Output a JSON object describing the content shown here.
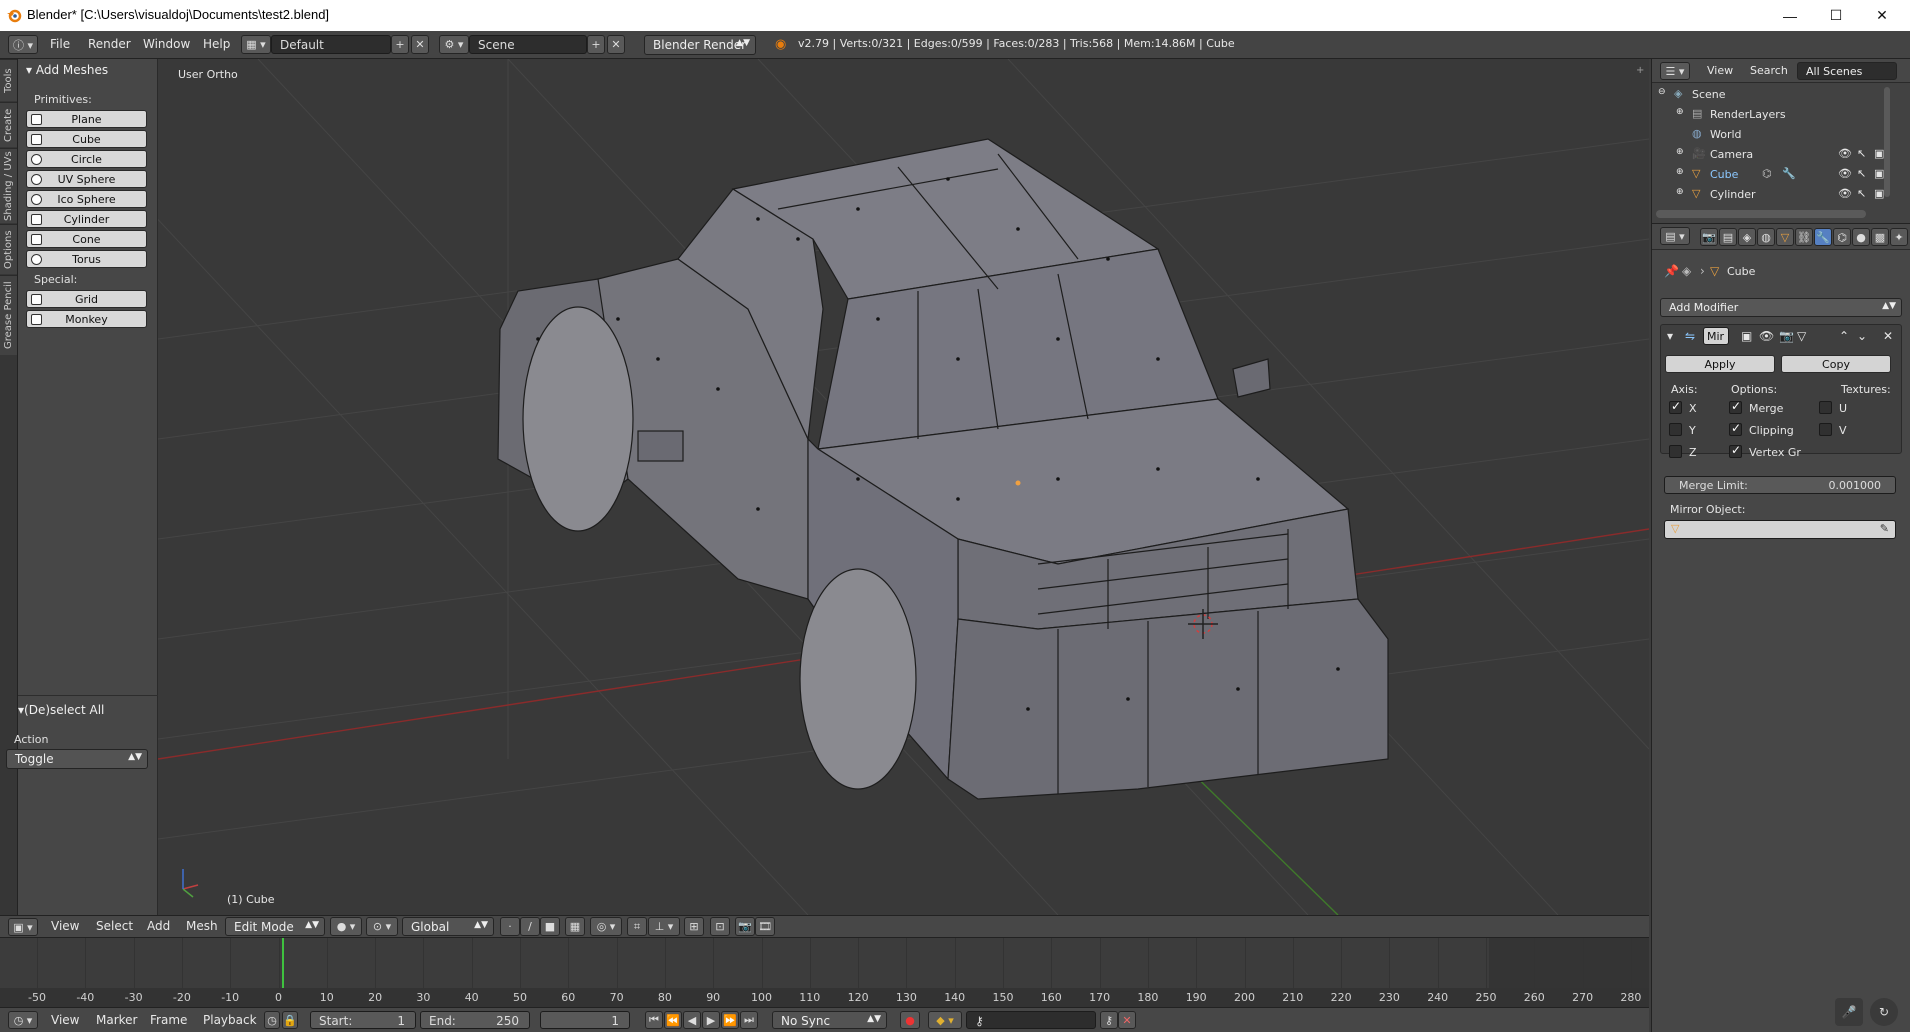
{
  "window": {
    "title": "Blender* [C:\\Users\\visualdoj\\Documents\\test2.blend]",
    "minimize": "—",
    "maximize": "☐",
    "close": "✕"
  },
  "infobar": {
    "menus": [
      "File",
      "Render",
      "Window",
      "Help"
    ],
    "screen_layout": "Default",
    "scene": "Scene",
    "render_engine": "Blender Render",
    "stats": "v2.79 | Verts:0/321 | Edges:0/599 | Faces:0/283 | Tris:568 | Mem:14.86M | Cube"
  },
  "left_tabs": [
    "Tools",
    "Create",
    "Shading / UVs",
    "Options",
    "Grease Pencil"
  ],
  "toolshelf": {
    "add_meshes_header": "Add Meshes",
    "primitives_label": "Primitives:",
    "primitives": [
      "Plane",
      "Cube",
      "Circle",
      "UV Sphere",
      "Ico Sphere",
      "Cylinder",
      "Cone",
      "Torus"
    ],
    "special_label": "Special:",
    "special": [
      "Grid",
      "Monkey"
    ],
    "operator_header": "(De)select All",
    "action_label": "Action",
    "action_value": "Toggle"
  },
  "viewport": {
    "view_label": "User Ortho",
    "object_label": "(1) Cube"
  },
  "view3d_header": {
    "menus": [
      "View",
      "Select",
      "Add",
      "Mesh"
    ],
    "mode": "Edit Mode",
    "orientation": "Global"
  },
  "timeline": {
    "ticks": [
      "-50",
      "-40",
      "-30",
      "-20",
      "-10",
      "0",
      "10",
      "20",
      "30",
      "40",
      "50",
      "60",
      "70",
      "80",
      "90",
      "100",
      "110",
      "120",
      "130",
      "140",
      "150",
      "160",
      "170",
      "180",
      "190",
      "200",
      "210",
      "220",
      "230",
      "240",
      "250",
      "260",
      "270",
      "280"
    ],
    "current_frame": 1
  },
  "timeline_header": {
    "menus": [
      "View",
      "Marker",
      "Frame",
      "Playback"
    ],
    "start_label": "Start:",
    "start_value": "1",
    "end_label": "End:",
    "end_value": "250",
    "frame_value": "1",
    "sync": "No Sync"
  },
  "outliner": {
    "menus": [
      "View",
      "Search"
    ],
    "filter": "All Scenes",
    "items": [
      "Scene",
      "RenderLayers",
      "World",
      "Camera",
      "Cube",
      "Cylinder"
    ]
  },
  "properties": {
    "context_object": "Cube",
    "add_modifier": "Add Modifier",
    "modifier_name": "Mir",
    "apply": "Apply",
    "copy": "Copy",
    "axis_label": "Axis:",
    "options_label": "Options:",
    "textures_label": "Textures:",
    "axis": [
      {
        "label": "X",
        "checked": true
      },
      {
        "label": "Y",
        "checked": false
      },
      {
        "label": "Z",
        "checked": false
      }
    ],
    "options": [
      {
        "label": "Merge",
        "checked": true
      },
      {
        "label": "Clipping",
        "checked": true
      },
      {
        "label": "Vertex Gr",
        "checked": true
      }
    ],
    "textures": [
      {
        "label": "U",
        "checked": false
      },
      {
        "label": "V",
        "checked": false
      }
    ],
    "merge_limit_label": "Merge Limit:",
    "merge_limit_value": "0.001000",
    "mirror_object_label": "Mirror Object:"
  },
  "colors": {
    "accent": "#5680c2",
    "active_object": "#f0a040",
    "x_axis": "#b03030",
    "y_axis": "#4a8a2a"
  }
}
